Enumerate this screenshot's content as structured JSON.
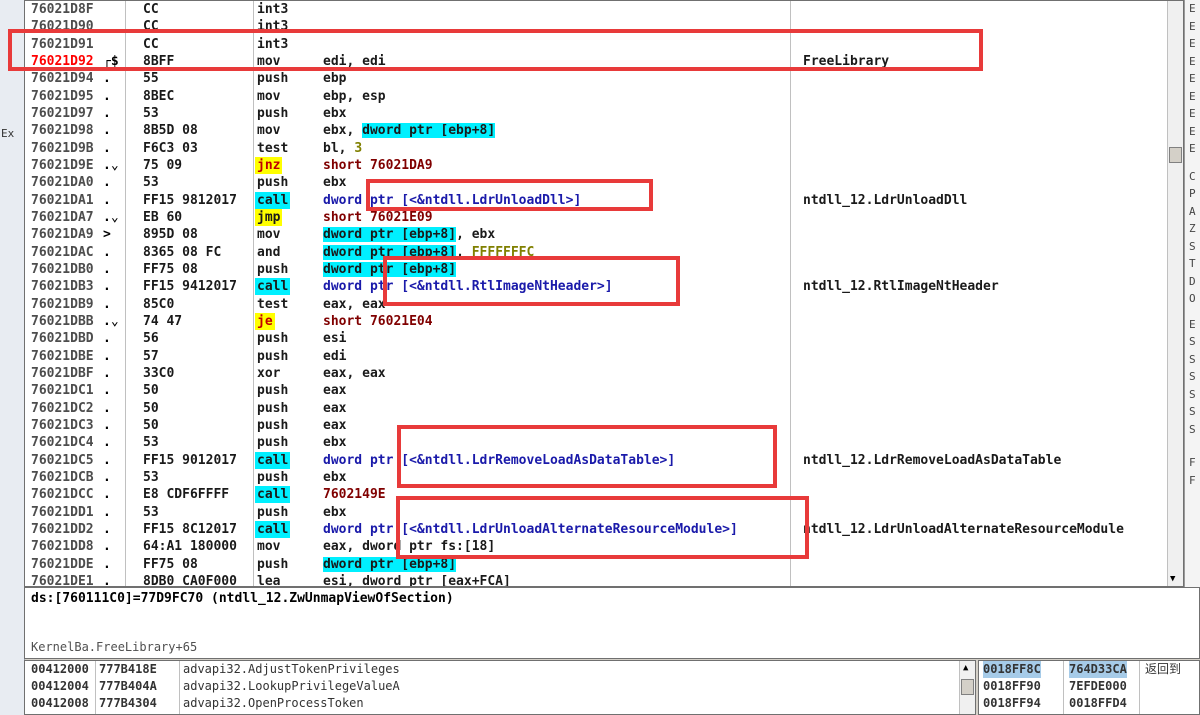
{
  "left_strip": {
    "label": "Ex"
  },
  "disasm": {
    "rows": [
      {
        "addr": "76021D8F",
        "arrow": "",
        "bytes": "CC",
        "mnemonic": "int3",
        "operand": "",
        "comment": ""
      },
      {
        "addr": "76021D90",
        "arrow": "",
        "bytes": "CC",
        "mnemonic": "int3",
        "operand": "",
        "comment": ""
      },
      {
        "addr": "76021D91",
        "arrow": "",
        "bytes": "CC",
        "mnemonic": "int3",
        "operand": "",
        "comment": ""
      },
      {
        "addr": "76021D92",
        "arrow": "┌$",
        "bytes": "8BFF",
        "mnemonic": "mov",
        "operand": "edi, edi",
        "comment": "FreeLibrary"
      },
      {
        "addr": "76021D94",
        "arrow": ".",
        "bytes": "55",
        "mnemonic": "push",
        "operand": "ebp",
        "comment": ""
      },
      {
        "addr": "76021D95",
        "arrow": ".",
        "bytes": "8BEC",
        "mnemonic": "mov",
        "operand": "ebp, esp",
        "comment": ""
      },
      {
        "addr": "76021D97",
        "arrow": ".",
        "bytes": "53",
        "mnemonic": "push",
        "operand": "ebx",
        "comment": ""
      },
      {
        "addr": "76021D98",
        "arrow": ".",
        "bytes": "8B5D 08",
        "mnemonic": "mov",
        "operand": "ebx, ",
        "operand_ref": "dword ptr [ebp+8]",
        "comment": ""
      },
      {
        "addr": "76021D9B",
        "arrow": ".",
        "bytes": "F6C3 03",
        "mnemonic": "test",
        "operand": "bl, ",
        "operand_imm": "3",
        "comment": ""
      },
      {
        "addr": "76021D9E",
        "arrow": ".⌄",
        "bytes": "75 09",
        "mnemonic": "jnz",
        "operand": "short 76021DA9",
        "comment": ""
      },
      {
        "addr": "76021DA0",
        "arrow": ".",
        "bytes": "53",
        "mnemonic": "push",
        "operand": "ebx",
        "comment": ""
      },
      {
        "addr": "76021DA1",
        "arrow": ".",
        "bytes": "FF15 9812017",
        "mnemonic": "call",
        "operand": "dword ptr [<&ntdll.LdrUnloadDll>]",
        "comment": "ntdll_12.LdrUnloadDll"
      },
      {
        "addr": "76021DA7",
        "arrow": ".⌄",
        "bytes": "EB 60",
        "mnemonic": "jmp",
        "operand": "short 76021E09",
        "comment": ""
      },
      {
        "addr": "76021DA9",
        "arrow": ">",
        "bytes": "895D 08",
        "mnemonic": "mov",
        "operand_ref": "dword ptr [ebp+8]",
        "operand": ", ebx",
        "comment": ""
      },
      {
        "addr": "76021DAC",
        "arrow": ".",
        "bytes": "8365 08 FC",
        "mnemonic": "and",
        "operand_ref": "dword ptr [ebp+8]",
        "operand": ", ",
        "operand_imm": "FFFFFFFC",
        "comment": ""
      },
      {
        "addr": "76021DB0",
        "arrow": ".",
        "bytes": "FF75 08",
        "mnemonic": "push",
        "operand_ref": "dword ptr [ebp+8]",
        "operand": "",
        "comment": ""
      },
      {
        "addr": "76021DB3",
        "arrow": ".",
        "bytes": "FF15 9412017",
        "mnemonic": "call",
        "operand": "dword ptr [<&ntdll.RtlImageNtHeader>]",
        "comment": "ntdll_12.RtlImageNtHeader"
      },
      {
        "addr": "76021DB9",
        "arrow": ".",
        "bytes": "85C0",
        "mnemonic": "test",
        "operand": "eax, eax",
        "comment": ""
      },
      {
        "addr": "76021DBB",
        "arrow": ".⌄",
        "bytes": "74 47",
        "mnemonic": "je",
        "operand": "short 76021E04",
        "comment": ""
      },
      {
        "addr": "76021DBD",
        "arrow": ".",
        "bytes": "56",
        "mnemonic": "push",
        "operand": "esi",
        "comment": ""
      },
      {
        "addr": "76021DBE",
        "arrow": ".",
        "bytes": "57",
        "mnemonic": "push",
        "operand": "edi",
        "comment": ""
      },
      {
        "addr": "76021DBF",
        "arrow": ".",
        "bytes": "33C0",
        "mnemonic": "xor",
        "operand": "eax, eax",
        "comment": ""
      },
      {
        "addr": "76021DC1",
        "arrow": ".",
        "bytes": "50",
        "mnemonic": "push",
        "operand": "eax",
        "comment": ""
      },
      {
        "addr": "76021DC2",
        "arrow": ".",
        "bytes": "50",
        "mnemonic": "push",
        "operand": "eax",
        "comment": ""
      },
      {
        "addr": "76021DC3",
        "arrow": ".",
        "bytes": "50",
        "mnemonic": "push",
        "operand": "eax",
        "comment": ""
      },
      {
        "addr": "76021DC4",
        "arrow": ".",
        "bytes": "53",
        "mnemonic": "push",
        "operand": "ebx",
        "comment": ""
      },
      {
        "addr": "76021DC5",
        "arrow": ".",
        "bytes": "FF15 9012017",
        "mnemonic": "call",
        "operand": "dword ptr [<&ntdll.LdrRemoveLoadAsDataTable>]",
        "comment": "ntdll_12.LdrRemoveLoadAsDataTable"
      },
      {
        "addr": "76021DCB",
        "arrow": ".",
        "bytes": "53",
        "mnemonic": "push",
        "operand": "ebx",
        "comment": ""
      },
      {
        "addr": "76021DCC",
        "arrow": ".",
        "bytes": "E8 CDF6FFFF",
        "mnemonic": "call",
        "operand": "7602149E",
        "comment": ""
      },
      {
        "addr": "76021DD1",
        "arrow": ".",
        "bytes": "53",
        "mnemonic": "push",
        "operand": "ebx",
        "comment": ""
      },
      {
        "addr": "76021DD2",
        "arrow": ".",
        "bytes": "FF15 8C12017",
        "mnemonic": "call",
        "operand": "dword ptr [<&ntdll.LdrUnloadAlternateResourceModule>]",
        "comment": "ntdll_12.LdrUnloadAlternateResourceModule"
      },
      {
        "addr": "76021DD8",
        "arrow": ".",
        "bytes": "64:A1 180000",
        "mnemonic": "mov",
        "operand": "eax, dword ptr fs:[18]",
        "comment": ""
      },
      {
        "addr": "76021DDE",
        "arrow": ".",
        "bytes": "FF75 08",
        "mnemonic": "push",
        "operand_ref": "dword ptr [ebp+8]",
        "operand": "",
        "comment": ""
      },
      {
        "addr": "76021DE1",
        "arrow": ".",
        "bytes": "8DB0 CA0F000",
        "mnemonic": "lea",
        "operand": "esi, dword ptr [eax+FCA]",
        "comment": ""
      }
    ]
  },
  "register_strip": {
    "letters": [
      "E",
      "E",
      "E",
      "E",
      "E",
      "E",
      "E",
      "E",
      "E",
      "C",
      "P",
      "A",
      "Z",
      "S",
      "T",
      "D",
      "O",
      "E",
      "S",
      "S",
      "S",
      "S",
      "S",
      "S",
      "F",
      "F"
    ]
  },
  "info": {
    "line1": "ds:[760111C0]=77D9FC70 (ntdll_12.ZwUnmapViewOfSection)",
    "line2": "KernelBa.FreeLibrary+65"
  },
  "dump": {
    "rows": [
      {
        "addr": "00412000",
        "hex": "777B418E",
        "symbol": "advapi32.AdjustTokenPrivileges"
      },
      {
        "addr": "00412004",
        "hex": "777B404A",
        "symbol": "advapi32.LookupPrivilegeValueA"
      },
      {
        "addr": "00412008",
        "hex": "777B4304",
        "symbol": "advapi32.OpenProcessToken"
      }
    ]
  },
  "stack": {
    "rows": [
      {
        "addr": "0018FF8C",
        "val": "764D33CA",
        "comment": "返回到"
      },
      {
        "addr": "0018FF90",
        "val": "7EFDE000",
        "comment": ""
      },
      {
        "addr": "0018FF94",
        "val": "0018FFD4",
        "comment": ""
      }
    ]
  },
  "colors": {
    "annotation": "#e83a3a",
    "call_bg": "#00f0ff",
    "jump_bg": "#ffff00",
    "current_addr": "#ff0000"
  }
}
